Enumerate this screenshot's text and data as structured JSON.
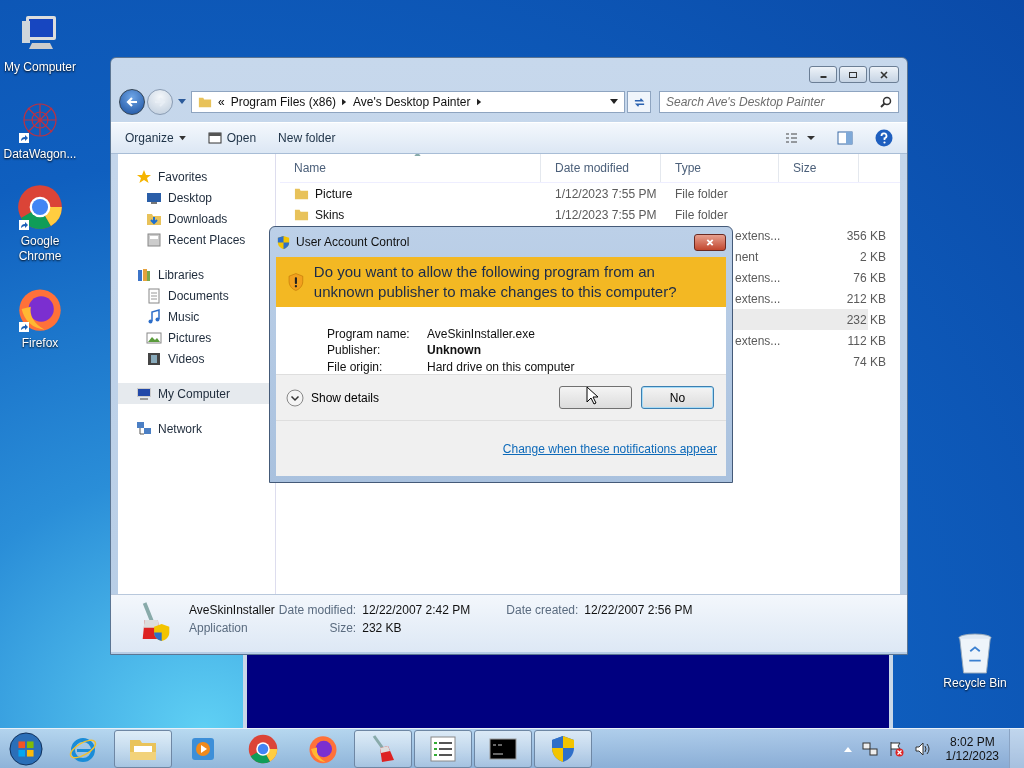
{
  "desktop_icons": [
    {
      "kind": "computer",
      "label": "My Computer",
      "shortcut": false
    },
    {
      "kind": "network-art",
      "label": "DataWagon...",
      "shortcut": true
    },
    {
      "kind": "chrome",
      "label": "Google Chrome",
      "shortcut": true
    },
    {
      "kind": "firefox",
      "label": "Firefox",
      "shortcut": true
    }
  ],
  "recycle_bin": {
    "label": "Recycle Bin"
  },
  "explorer": {
    "address": [
      "Program Files (x86)",
      "Ave's Desktop Painter"
    ],
    "overflow": "«",
    "search": {
      "placeholder": "Search Ave's Desktop Painter"
    },
    "toolbar": [
      {
        "kind": "menu",
        "label": "Organize"
      },
      {
        "kind": "open",
        "label": "Open"
      },
      {
        "kind": "plain",
        "label": "New folder"
      }
    ],
    "nav": [
      {
        "kind": "star",
        "label": "Favorites",
        "selected": false,
        "children": [
          {
            "kind": "desktop",
            "label": "Desktop",
            "selected": false
          },
          {
            "kind": "downloads",
            "label": "Downloads",
            "selected": false
          },
          {
            "kind": "recent",
            "label": "Recent Places",
            "selected": false
          }
        ]
      },
      {
        "kind": "library",
        "label": "Libraries",
        "selected": false,
        "children": [
          {
            "kind": "document",
            "label": "Documents",
            "selected": false
          },
          {
            "kind": "music",
            "label": "Music",
            "selected": false
          },
          {
            "kind": "picture",
            "label": "Pictures",
            "selected": false
          },
          {
            "kind": "video",
            "label": "Videos",
            "selected": false
          }
        ]
      },
      {
        "kind": "computer",
        "label": "My Computer",
        "selected": true
      },
      {
        "kind": "network",
        "label": "Network",
        "selected": false
      }
    ],
    "columns": [
      "Name",
      "Date modified",
      "Type",
      "Size"
    ],
    "rows": [
      {
        "name": "Picture",
        "date": "1/12/2023 7:55 PM",
        "type": "File folder",
        "selected": false
      },
      {
        "name": "Skins",
        "date": "1/12/2023 7:55 PM",
        "type": "File folder",
        "selected": false
      },
      {
        "type": "extens...",
        "size": "356 KB",
        "selected": false
      },
      {
        "type": "nent",
        "size": "2 KB",
        "selected": false
      },
      {
        "type": "extens...",
        "size": "76 KB",
        "selected": false
      },
      {
        "type": "extens...",
        "size": "212 KB",
        "selected": false
      },
      {
        "size": "232 KB",
        "selected": true
      },
      {
        "type": "extens...",
        "size": "112 KB",
        "selected": false
      },
      {
        "size": "74 KB",
        "selected": false
      }
    ],
    "details": {
      "name": "AveSkinInstaller",
      "kind": "Application",
      "fields": [
        {
          "label": "Date modified:",
          "value": "12/22/2007 2:42 PM"
        },
        {
          "label": "Date created:",
          "value": "12/22/2007 2:56 PM"
        },
        {
          "label": "Size:",
          "value": "232 KB"
        }
      ]
    }
  },
  "uac": {
    "title": "User Account Control",
    "question": "Do you want to allow the following program from an unknown publisher to make changes to this computer?",
    "fields": [
      {
        "label": "Program name:",
        "value": "AveSkinInstaller.exe",
        "bold": false
      },
      {
        "label": "Publisher:",
        "value": "Unknown",
        "bold": true
      },
      {
        "label": "File origin:",
        "value": "Hard drive on this computer",
        "bold": false
      }
    ],
    "show_details": "Show details",
    "buttons": [
      {
        "default": false
      },
      {
        "label": "No",
        "default": true
      }
    ],
    "link": "Change when these notifications appear"
  },
  "taskbar": {
    "items": [
      {
        "kind": "ie",
        "active": false
      },
      {
        "kind": "folder",
        "active": true
      },
      {
        "kind": "media",
        "active": false
      },
      {
        "kind": "chrome",
        "active": false
      },
      {
        "kind": "firefox",
        "active": false
      },
      {
        "kind": "brush",
        "active": true
      },
      {
        "kind": "list",
        "active": true
      },
      {
        "kind": "cmd",
        "active": true
      },
      {
        "kind": "shield",
        "active": true
      }
    ],
    "time": "8:02 PM",
    "date": "1/12/2023"
  }
}
